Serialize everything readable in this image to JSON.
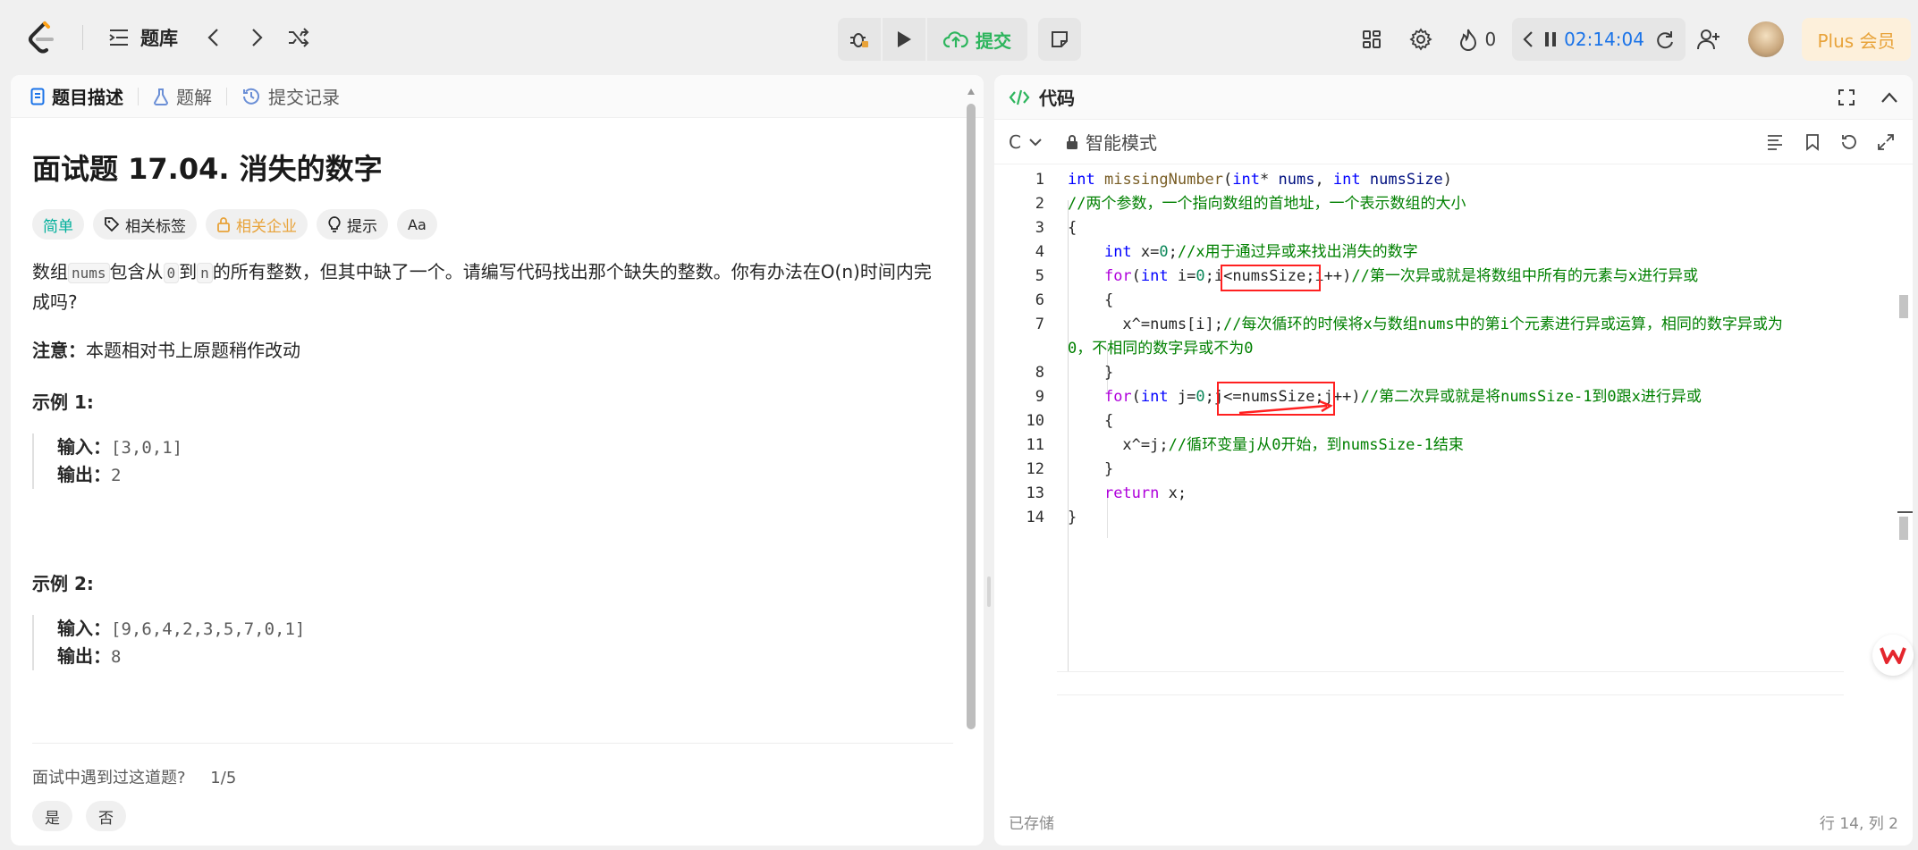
{
  "topbar": {
    "problem_bank_label": "题库",
    "submit_label": "提交",
    "streak_count": "0",
    "timer": "02:14:04",
    "plus_label": "Plus 会员"
  },
  "left": {
    "tabs": [
      {
        "label": "题目描述"
      },
      {
        "label": "题解"
      },
      {
        "label": "提交记录"
      }
    ],
    "title": "面试题 17.04. 消失的数字",
    "tags": {
      "difficulty": "简单",
      "related_tags": "相关标签",
      "related_companies": "相关企业",
      "hint": "提示",
      "font": "Aa"
    },
    "desc": {
      "p1": "数组",
      "code1": "nums",
      "p2": "包含从",
      "code2": "0",
      "p3": "到",
      "code3": "n",
      "p4": "的所有整数，但其中缺了一个。请编写代码找出那个缺失的整数。你有办法在O(n)时间内完成吗?"
    },
    "note_label": "注意：",
    "note_text": "本题相对书上原题稍作改动",
    "examples": [
      {
        "title": "示例 1:",
        "input_label": "输入：",
        "input": "[3,0,1]",
        "output_label": "输出：",
        "output": "2"
      },
      {
        "title": "示例 2:",
        "input_label": "输入：",
        "input": "[9,6,4,2,3,5,7,0,1]",
        "output_label": "输出：",
        "output": "8"
      }
    ],
    "interview_q": "面试中遇到过这道题?",
    "interview_count": "1/5",
    "yes": "是",
    "no": "否"
  },
  "right": {
    "tab_label": "代码",
    "lang": "C",
    "mode": "智能模式",
    "code_lines": [
      "1",
      "2",
      "3",
      "4",
      "5",
      "6",
      "7",
      "",
      "8",
      "9",
      "10",
      "11",
      "12",
      "13",
      "14"
    ],
    "status_saved": "已存储",
    "cursor_pos": "行 14, 列 2"
  },
  "colors": {
    "accent_green": "#00af9b",
    "accent_orange": "#e8a33a",
    "timer_blue": "#1a73e8",
    "highlight_red": "#ff2020"
  }
}
